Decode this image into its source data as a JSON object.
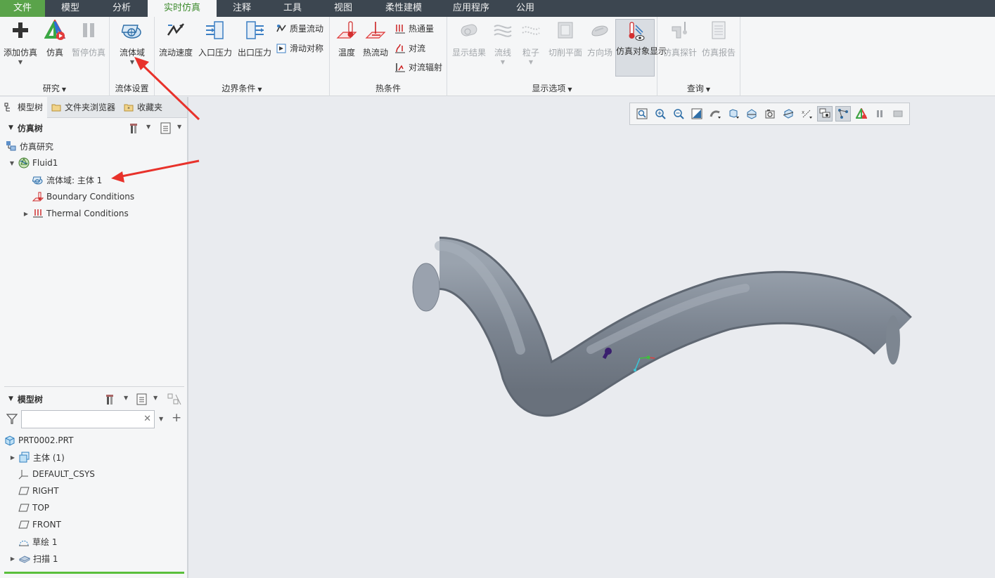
{
  "menu": {
    "tabs": [
      {
        "label": "文件"
      },
      {
        "label": "模型"
      },
      {
        "label": "分析"
      },
      {
        "label": "实时仿真"
      },
      {
        "label": "注释"
      },
      {
        "label": "工具"
      },
      {
        "label": "视图"
      },
      {
        "label": "柔性建模"
      },
      {
        "label": "应用程序"
      },
      {
        "label": "公用"
      }
    ],
    "active_tab": "实时仿真"
  },
  "ribbon": {
    "study": {
      "label": "研究",
      "add_sim": "添加仿真",
      "simulate": "仿真",
      "pause_sim": "暂停仿真"
    },
    "fluid_setup": {
      "label": "流体设置",
      "fluid_domain": "流体域"
    },
    "boundary": {
      "label": "边界条件",
      "flow_velocity": "流动速度",
      "inlet_pressure": "入口压力",
      "outlet_pressure": "出口压力",
      "mass_flow": "质量流动",
      "slip_symmetry": "滑动对称"
    },
    "thermal": {
      "label": "热条件",
      "temperature": "温度",
      "heat_flow": "热流动",
      "heat_flux": "热通量",
      "convection": "对流",
      "convection_radiation": "对流辐射"
    },
    "display": {
      "label": "显示选项",
      "show_results": "显示结果",
      "streamlines": "流线",
      "particles": "粒子",
      "cutting_plane": "切削平面",
      "direction_field": "方向场",
      "sim_object_display": "仿真对象显示"
    },
    "query": {
      "label": "查询",
      "sim_probe": "仿真探针",
      "sim_report": "仿真报告"
    }
  },
  "left_tabs": [
    {
      "label": "模型树"
    },
    {
      "label": "文件夹浏览器"
    },
    {
      "label": "收藏夹"
    }
  ],
  "sim_tree": {
    "header": "仿真树",
    "items": [
      {
        "label": "仿真研究"
      },
      {
        "label": "Fluid1"
      },
      {
        "label": "流体域: 主体 1"
      },
      {
        "label": "Boundary Conditions"
      },
      {
        "label": "Thermal Conditions"
      }
    ]
  },
  "model_tree": {
    "header": "模型树",
    "filter_value": "",
    "items": [
      {
        "label": "PRT0002.PRT"
      },
      {
        "label": "主体 (1)"
      },
      {
        "label": "DEFAULT_CSYS"
      },
      {
        "label": "RIGHT"
      },
      {
        "label": "TOP"
      },
      {
        "label": "FRONT"
      },
      {
        "label": "草绘 1"
      },
      {
        "label": "扫描 1"
      }
    ]
  },
  "colors": {
    "menubar": "#3c4650",
    "file_tab": "#5aa34a",
    "active_tab_text": "#3d8b2d",
    "annotation_arrow": "#e8322b",
    "pipe": "#8a939f"
  }
}
